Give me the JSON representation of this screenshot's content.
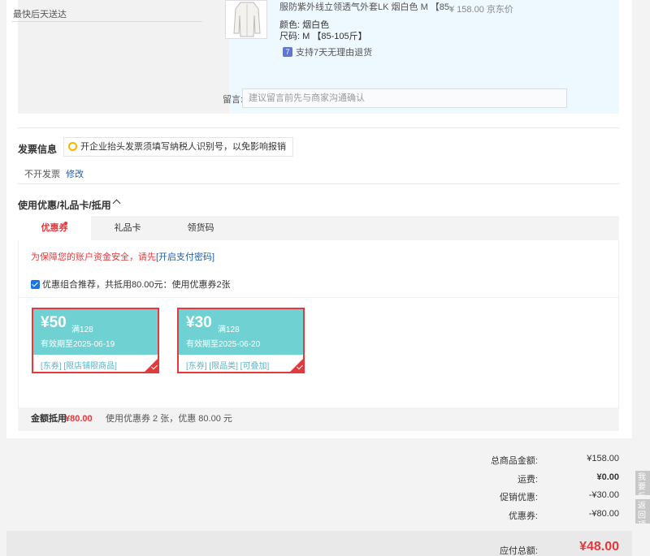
{
  "shipping": {
    "delivery_text": "最快后天送达",
    "product_name": "服防紫外线立领透气外套LK 烟白色 M 【85-",
    "price": "¥ 158.00 京东价",
    "color_label": "颜色:",
    "color_value": "烟白色",
    "size_label": "尺码:",
    "size_value": "M 【85-105斤】",
    "return_badge": "7",
    "return_text": "支持7天无理由退货",
    "message_label": "留言:",
    "message_placeholder": "建议留言前先与商家沟通确认"
  },
  "invoice": {
    "title": "发票信息",
    "tip": "开企业抬头发票须填写纳税人识别号，以免影响报销",
    "value": "不开发票",
    "edit_label": "修改"
  },
  "discount": {
    "title": "使用优惠/礼品卡/抵用",
    "tabs": [
      "优惠券",
      "礼品卡",
      "领货码"
    ],
    "warning_text": "为保障您的账户资金安全，请先",
    "warning_link": "[开启支付密码]",
    "combo_text": "优惠组合推荐，共抵用80.00元：使用优惠券2张",
    "combo_checked": true,
    "coupons": [
      {
        "amount": "¥50",
        "min": "满128",
        "expiry": "有效期至2025-06-19",
        "tags": "[东券]   [限店铺限商品]",
        "selected": true
      },
      {
        "amount": "¥30",
        "min": "满128",
        "expiry": "有效期至2025-06-20",
        "tags": "[东券]   [限品类]   [可叠加]",
        "selected": true
      }
    ],
    "summary_label": "金额抵用",
    "summary_amount": "¥80.00",
    "summary_desc": "使用优惠券 2 张，优惠 80.00 元"
  },
  "totals": {
    "rows": [
      {
        "label": "总商品金额:",
        "value": "¥158.00"
      },
      {
        "label": "运费:",
        "value": "¥0.00"
      },
      {
        "label": "促销优惠:",
        "value": "-¥30.00"
      },
      {
        "label": "优惠券:",
        "value": "-¥80.00"
      }
    ],
    "payable_label": "应付总额:",
    "payable_value": "¥48.00"
  },
  "side": {
    "feedback": "我要反馈",
    "back_top": "返回顶部"
  },
  "colors": {
    "accent_red": "#e4393c",
    "coupon_teal": "#70d1d3",
    "link_blue": "#1f5ea8"
  }
}
